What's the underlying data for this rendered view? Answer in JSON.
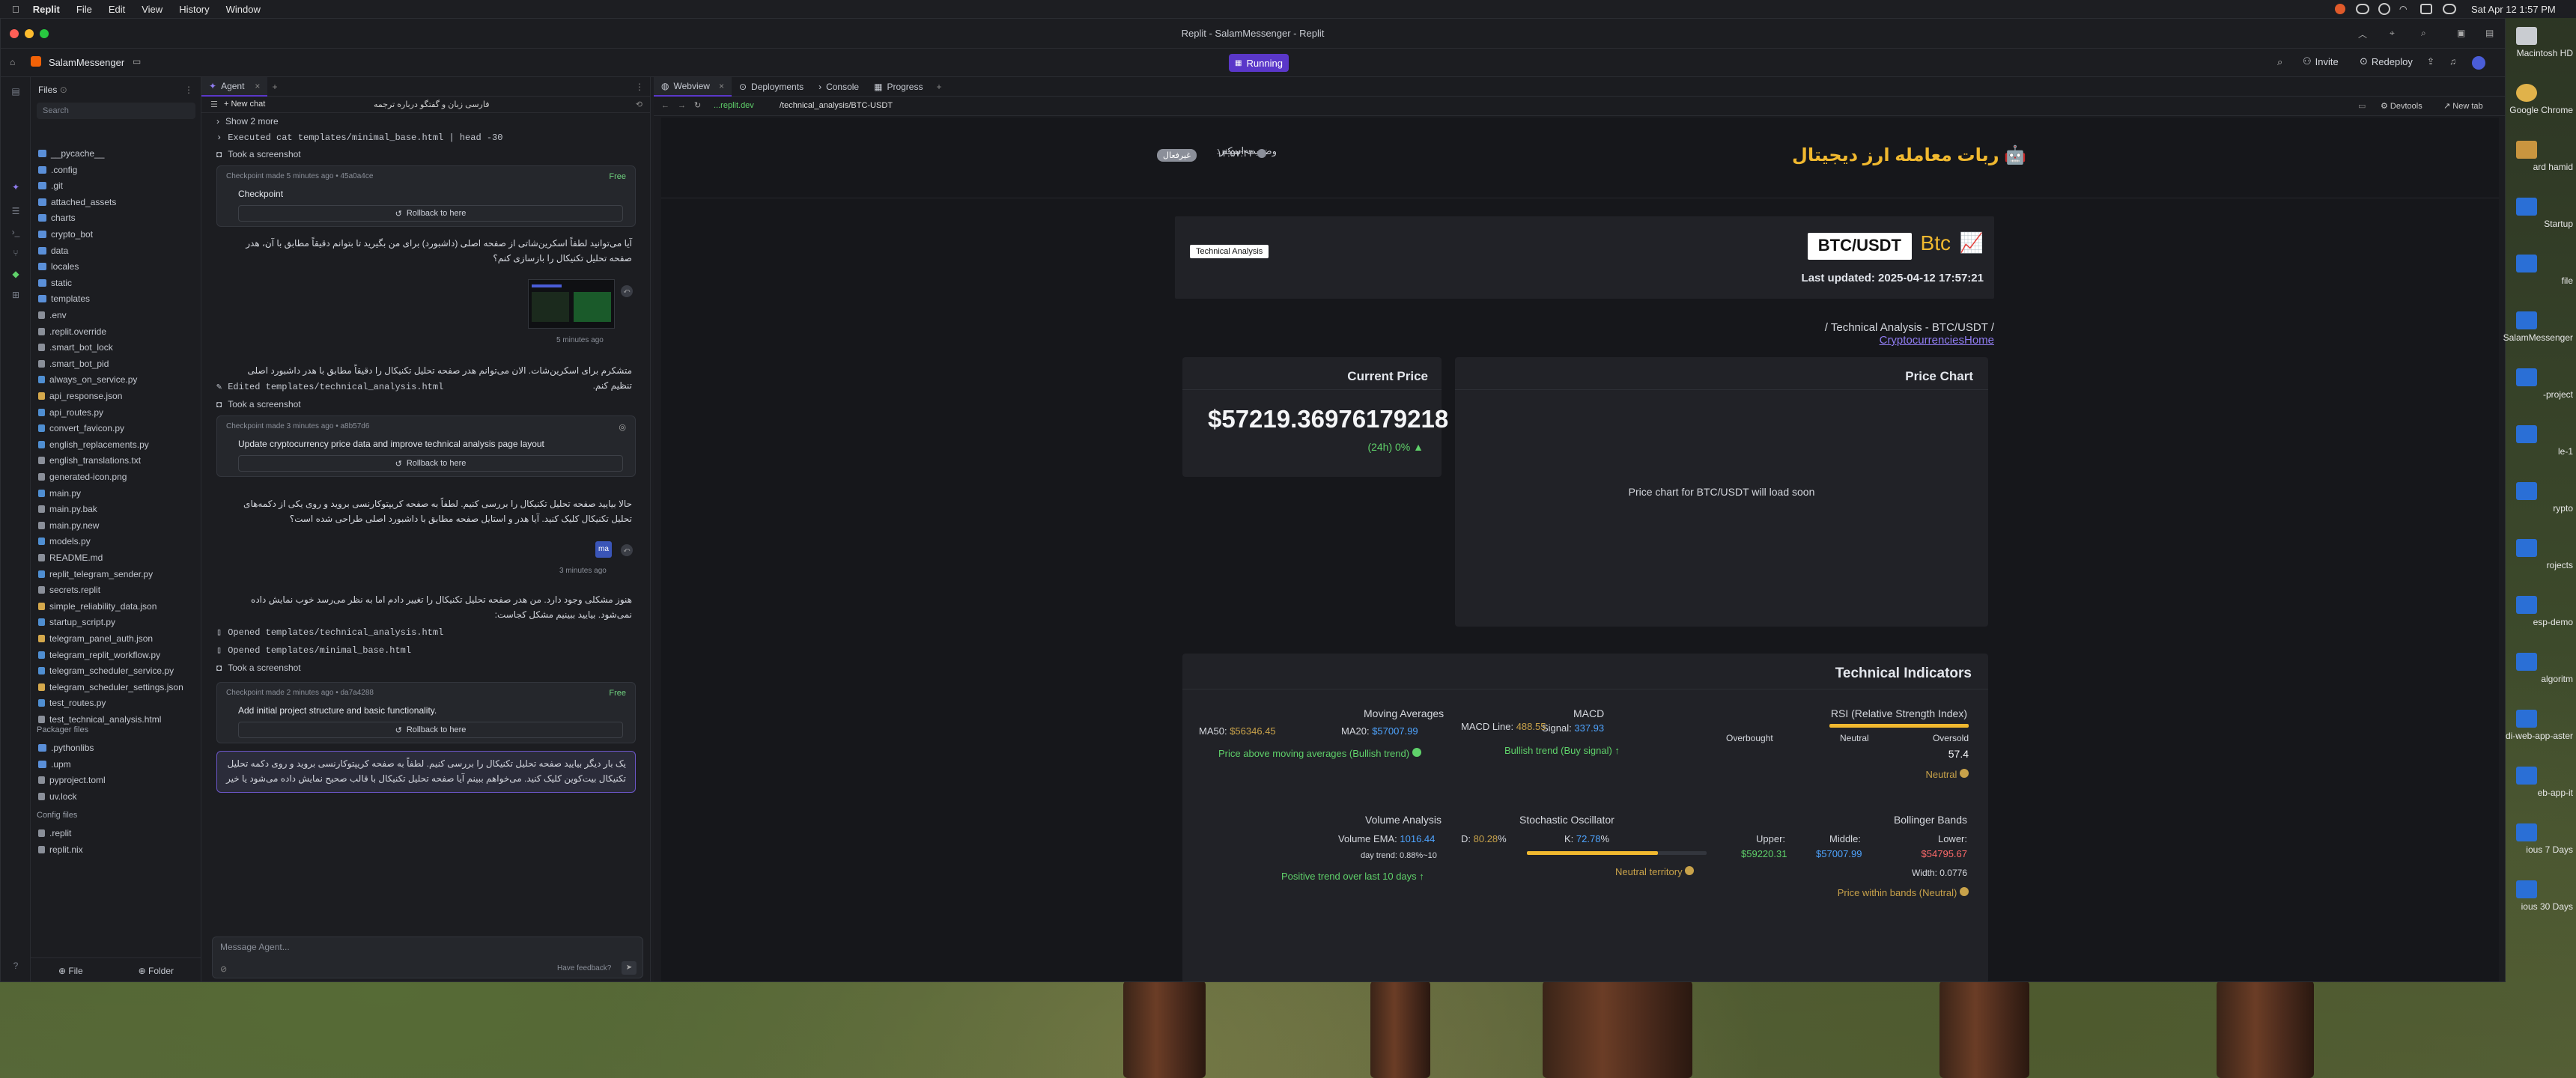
{
  "menubar": {
    "apple": "",
    "app": "Replit",
    "items": [
      "File",
      "Edit",
      "View",
      "History",
      "Window"
    ],
    "datetime": "Sat Apr 12  1:57 PM"
  },
  "window": {
    "title": "Replit - SalamMessenger - Replit"
  },
  "toprow": {
    "repl_name": "SalamMessenger",
    "run_label": "Running",
    "invite_label": "Invite",
    "redeploy_label": "Redeploy"
  },
  "files": {
    "header": "Files",
    "search_placeholder": "Search",
    "items": [
      "__pycache__",
      ".config",
      ".git",
      "attached_assets",
      "charts",
      "crypto_bot",
      "data",
      "locales",
      "static",
      "templates",
      ".env",
      ".replit.override",
      ".smart_bot_lock",
      ".smart_bot_pid",
      "always_on_service.py",
      "api_response.json",
      "api_routes.py",
      "convert_favicon.py",
      "english_replacements.py",
      "english_translations.txt",
      "generated-icon.png",
      "main.py",
      "main.py.bak",
      "main.py.new",
      "models.py",
      "README.md",
      "replit_telegram_sender.py",
      "secrets.replit",
      "simple_reliability_data.json",
      "startup_script.py",
      "telegram_panel_auth.json",
      "telegram_replit_workflow.py",
      "telegram_scheduler_service.py",
      "telegram_scheduler_settings.json",
      "test_routes.py",
      "test_technical_analysis.html"
    ],
    "packager_header": "Packager files",
    "packager_items": [
      ".pythonlibs",
      ".upm",
      "pyproject.toml",
      "uv.lock"
    ],
    "config_header": "Config files",
    "config_items": [
      ".replit",
      "replit.nix"
    ],
    "bottom_file": "File",
    "bottom_folder": "Folder"
  },
  "agent": {
    "tab_label": "Agent",
    "new_chat": "New chat",
    "chat_title": "فارسی زبان و گفتگو درباره ترجمه",
    "show_more": "Show 2 more",
    "executed": "Executed cat templates/minimal_base.html | head -30",
    "took_screenshot_1": "Took a screenshot",
    "checkpoint_1": {
      "meta": "Checkpoint made 5 minutes ago • 45a0a4ce",
      "free": "Free",
      "title": "Checkpoint",
      "rollback": "Rollback to here"
    },
    "user_msg_1": "آیا می‌توانید لطفاً اسکرین‌شاتی از صفحه اصلی (داشبورد) برای من بگیرید تا بتوانم دقیقاً مطابق با آن، هدر صفحه تحلیل تکنیکال را بازسازی کنم؟",
    "time_1": "5 minutes ago",
    "reply_1": "متشکرم برای اسکرین‌شات. الان می‌توانم هدر صفحه تحلیل تکنیکال را دقیقاً مطابق با هدر داشبورد اصلی تنظیم کنم.",
    "edited": "Edited templates/technical_analysis.html",
    "took_screenshot_2": "Took a screenshot",
    "checkpoint_2": {
      "meta": "Checkpoint made 3 minutes ago • a8b57d6",
      "title": "Update cryptocurrency price data and improve technical analysis page layout",
      "rollback": "Rollback to here"
    },
    "user_msg_2": "حالا بیایید صفحه تحلیل تکنیکال را بررسی کنیم. لطفاً به صفحه کریپتوکارنسی بروید و روی یکی از دکمه‌های تحلیل تکنیکال کلیک کنید. آیا هدر و استایل صفحه مطابق با داشبورد اصلی طراحی شده است؟",
    "avatar": "ma",
    "time_2": "3 minutes ago",
    "reply_2": "هنوز مشکلی وجود دارد. من هدر صفحه تحلیل تکنیکال را تغییر دادم اما به نظر می‌رسد خوب نمایش داده نمی‌شود. بیایید ببینیم مشکل کجاست:",
    "opened_1": "Opened templates/technical_analysis.html",
    "opened_2": "Opened templates/minimal_base.html",
    "took_screenshot_3": "Took a screenshot",
    "checkpoint_3": {
      "meta": "Checkpoint made 2 minutes ago • da7a4288",
      "free": "Free",
      "title": "Add initial project structure and basic functionality.",
      "rollback": "Rollback to here"
    },
    "user_msg_3": "یک بار دیگر بیایید صفحه تحلیل تکنیکال را بررسی کنیم. لطفاً به صفحه کریپتوکارنسی بروید و روی دکمه تحلیل تکنیکال بیت‌کوین کلیک کنید. می‌خواهم ببینم آیا صفحه تحلیل تکنیکال با قالب صحیح نمایش داده می‌شود یا خیر",
    "composer_placeholder": "Message Agent...",
    "feedback": "Have feedback?"
  },
  "webview": {
    "tabs": [
      "Webview",
      "Deployments",
      "Console",
      "Progress"
    ],
    "url_domain": "...replit.dev",
    "url_path": "/technical_analysis/BTC-USDT",
    "devtools": "Devtools",
    "newtab": "New tab"
  },
  "site": {
    "brand": "ربات معامله ارز دیجیتال",
    "brand_emoji": "🤖",
    "status_label": "وضعیت اسکنر:",
    "status_badge": "غیرفعال",
    "status_time": "۱۳:۵۷:۴۳",
    "pair": "BTC/USDT",
    "coin": "Btc",
    "tag": "Technical Analysis",
    "updated": "Last updated: 2025-04-12 17:57:21",
    "breadcrumb_home": "CryptocurrenciesHome",
    "breadcrumb_current": "Technical Analysis - BTC/USDT",
    "breadcrumb_sep": "/",
    "current_price_title": "Current Price",
    "price": "$57219.36976179218",
    "change": "(24h) 0% ▲",
    "chart_title": "Price Chart",
    "chart_placeholder": "Price chart for BTC/USDT will load soon",
    "indicators_title": "Technical Indicators",
    "rsi": {
      "title": "RSI (Relative Strength Index)",
      "overbought": "Overbought",
      "neutral": "Neutral",
      "oversold": "Oversold",
      "value": "57.4",
      "status": "Neutral"
    },
    "macd": {
      "title": "MACD",
      "signal_label": "Signal:",
      "signal_value": "337.93",
      "line_label": "MACD Line:",
      "line_value": "488.55",
      "status": "Bullish trend (Buy signal) ↑"
    },
    "ma": {
      "title": "Moving Averages",
      "ma20_label": "MA20:",
      "ma20_value": "$57007.99",
      "ma50_label": "MA50:",
      "ma50_value": "$56346.45",
      "status": "Price above moving averages (Bullish trend)"
    },
    "bb": {
      "title": "Bollinger Bands",
      "lower_label": "Lower:",
      "lower_value": "$54795.67",
      "middle_label": "Middle:",
      "middle_value": "$57007.99",
      "upper_label": "Upper:",
      "upper_value": "$59220.31",
      "width": "Width: 0.0776",
      "status": "Price within bands (Neutral)"
    },
    "stoch": {
      "title": "Stochastic Oscillator",
      "k_label": "K:",
      "k_value": "72.78",
      "k_pct": "%",
      "d_label": "D:",
      "d_value": "80.28",
      "d_pct": "%",
      "k_level": 0.7278,
      "status": "Neutral territory"
    },
    "vol": {
      "title": "Volume Analysis",
      "ema_label": "Volume EMA:",
      "ema_value": "1016.44",
      "trend": "day trend: 0.88%~10",
      "status": "Positive trend over last 10 days ↑"
    }
  },
  "dock": {
    "items": [
      "Macintosh HD",
      "Google Chrome",
      "ard hamid",
      "Startup",
      "file",
      "SalamMessenger",
      "-project",
      "le-1",
      "rypto",
      "rojects",
      "esp-demo",
      "algoritm",
      "di-web-app-aster",
      "eb-app-it",
      "ious 7 Days",
      "ious 30 Days"
    ]
  },
  "colors": {
    "accent": "#5a37c9",
    "gold": "#f0b82f",
    "green": "#5fd16a",
    "blue": "#4ea4ff",
    "red": "#ff6b6b",
    "muted_gold": "#c8a24a"
  }
}
